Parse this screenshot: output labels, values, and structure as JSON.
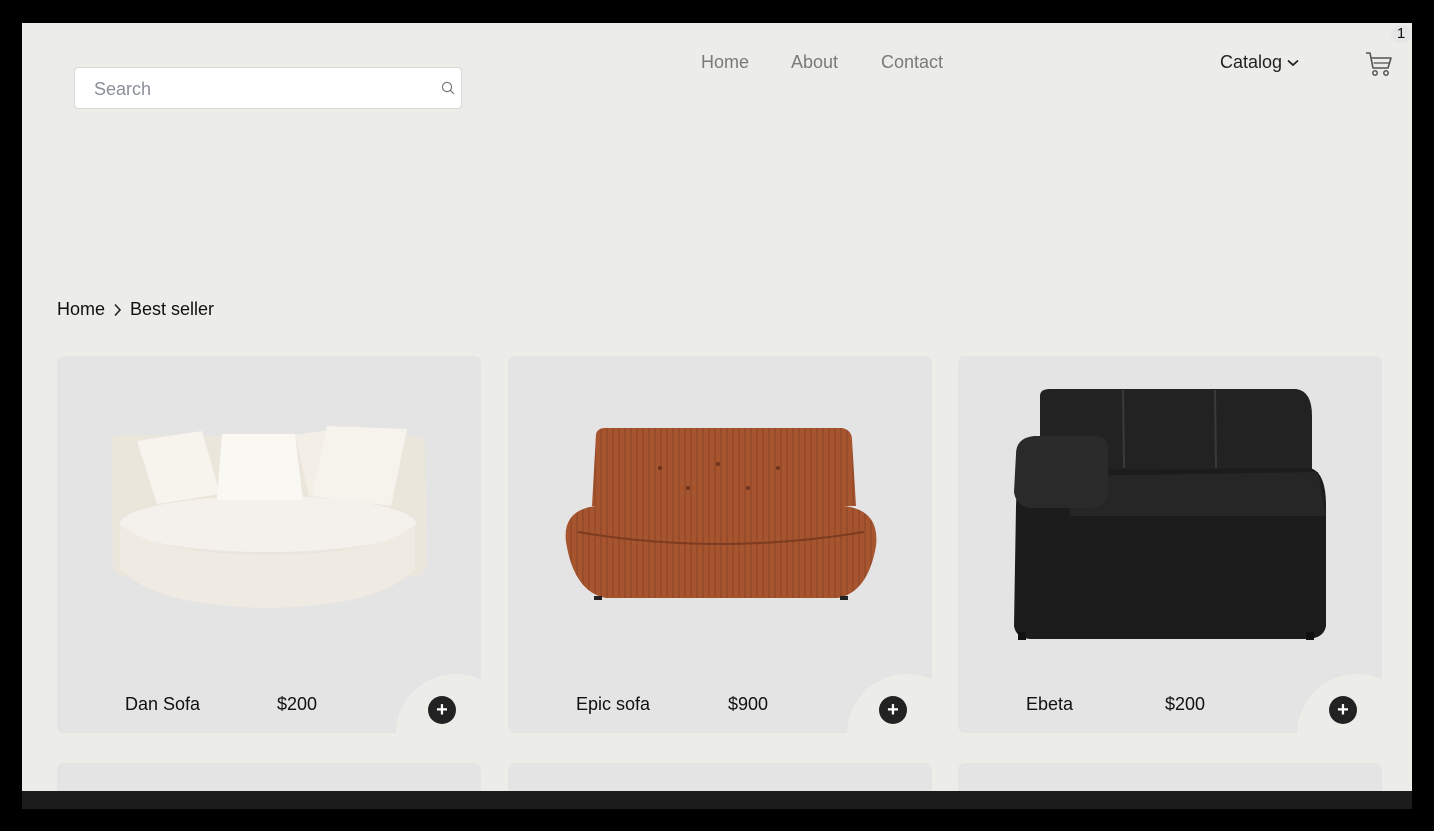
{
  "header": {
    "search": {
      "placeholder": "Search",
      "value": ""
    },
    "nav": [
      {
        "label": "Home"
      },
      {
        "label": "About"
      },
      {
        "label": "Contact"
      }
    ],
    "catalog_label": "Catalog",
    "cart_count": "1"
  },
  "breadcrumb": {
    "home": "Home",
    "current": "Best seller"
  },
  "products": [
    {
      "name": "Dan Sofa",
      "price": "$200",
      "color": "#f1ede6",
      "image": "white-round-sofa"
    },
    {
      "name": "Epic sofa",
      "price": "$900",
      "color": "#a9593a",
      "image": "brown-corduroy-sofa"
    },
    {
      "name": "Ebeta",
      "price": "$200",
      "color": "#1b1b1b",
      "image": "black-leather-corner-chair"
    }
  ],
  "colors": {
    "background": "#ecece8",
    "card": "#e4e4e4",
    "accent": "#222222"
  }
}
